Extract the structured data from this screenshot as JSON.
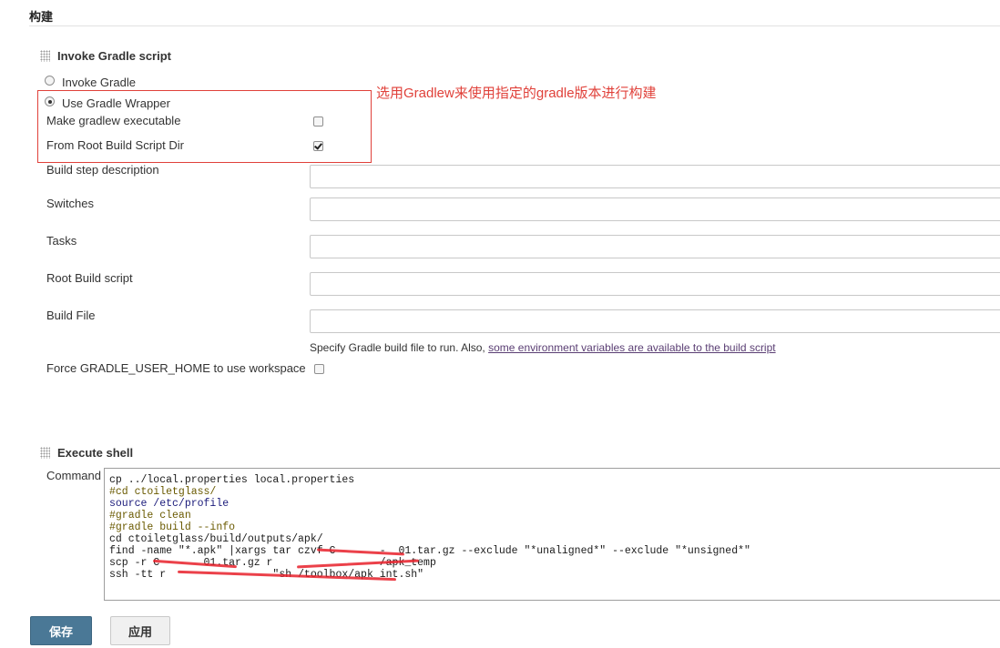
{
  "section": {
    "title": "构建"
  },
  "gradle_step": {
    "title": "Invoke Gradle script",
    "radio_invoke": "Invoke Gradle",
    "radio_wrapper": "Use Gradle Wrapper",
    "make_executable": "Make gradlew executable",
    "from_root_dir": "From Root Build Script Dir",
    "fields": {
      "build_step_description": "Build step description",
      "switches": "Switches",
      "tasks": "Tasks",
      "root_build_script": "Root Build script",
      "build_file": "Build File"
    },
    "hint_text": "Specify Gradle build file to run. Also, ",
    "hint_link": "some environment variables are available to the build script",
    "force_home": "Force GRADLE_USER_HOME to use workspace"
  },
  "annotation": "选用Gradlew来使用指定的gradle版本进行构建",
  "shell_step": {
    "title": "Execute shell",
    "command_label": "Command",
    "lines": [
      {
        "text": "cp ../local.properties local.properties",
        "style": "c-black"
      },
      {
        "text": "#cd ctoiletglass/",
        "style": "c-olive"
      },
      {
        "text": "source /etc/profile",
        "style": "c-blue"
      },
      {
        "text": "#gradle clean",
        "style": "c-olive"
      },
      {
        "text": "#gradle build --info",
        "style": "c-olive"
      },
      {
        "text": "cd ctoiletglass/build/outputs/apk/",
        "style": "c-black"
      },
      {
        "text": "find -name \"*.apk\" |xargs tar czvf C       -  01.tar.gz --exclude \"*unaligned*\" --exclude \"*unsigned*\"",
        "style": "c-black"
      },
      {
        "text": "scp -r C       01.tar.gz r                 /apk_temp",
        "style": "c-black"
      },
      {
        "text": "ssh -tt r                 \"sh /toolbox/apk_int.sh\"",
        "style": "c-black"
      }
    ]
  },
  "buttons": {
    "save": "保存",
    "apply": "应用"
  },
  "colors": {
    "annotation": "#e0413a",
    "primary_button": "#4a7896"
  }
}
